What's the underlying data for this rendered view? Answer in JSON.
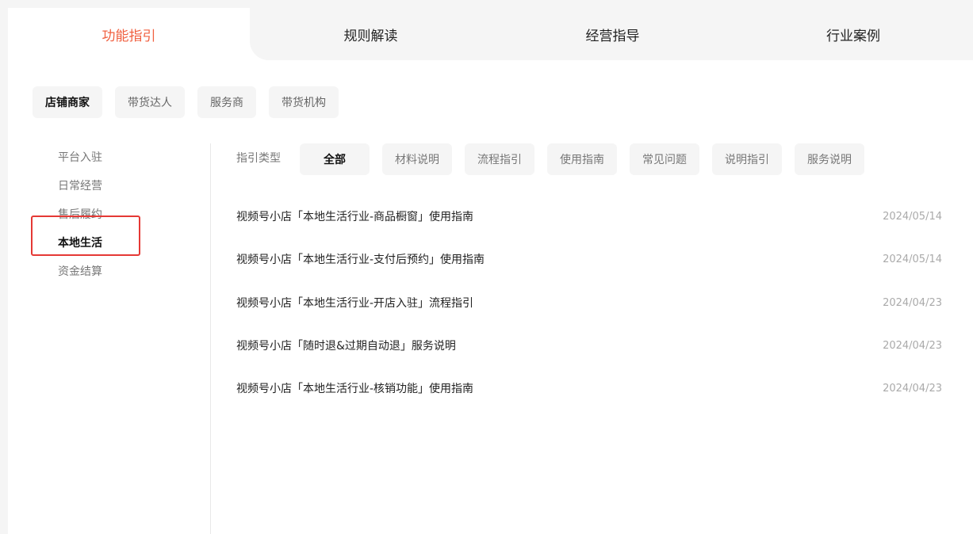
{
  "tabs": [
    {
      "label": "功能指引",
      "active": true
    },
    {
      "label": "规则解读",
      "active": false
    },
    {
      "label": "经营指导",
      "active": false
    },
    {
      "label": "行业案例",
      "active": false
    }
  ],
  "roles": [
    {
      "label": "店铺商家",
      "active": true
    },
    {
      "label": "带货达人",
      "active": false
    },
    {
      "label": "服务商",
      "active": false
    },
    {
      "label": "带货机构",
      "active": false
    }
  ],
  "sidenav": [
    {
      "label": "平台入驻",
      "active": false
    },
    {
      "label": "日常经营",
      "active": false
    },
    {
      "label": "售后履约",
      "active": false
    },
    {
      "label": "本地生活",
      "active": true
    },
    {
      "label": "资金结算",
      "active": false
    }
  ],
  "filter": {
    "label": "指引类型",
    "options": [
      {
        "label": "全部",
        "active": true
      },
      {
        "label": "材料说明",
        "active": false
      },
      {
        "label": "流程指引",
        "active": false
      },
      {
        "label": "使用指南",
        "active": false
      },
      {
        "label": "常见问题",
        "active": false
      },
      {
        "label": "说明指引",
        "active": false
      },
      {
        "label": "服务说明",
        "active": false
      }
    ]
  },
  "articles": [
    {
      "title": "视频号小店「本地生活行业-商品橱窗」使用指南",
      "date": "2024/05/14"
    },
    {
      "title": "视频号小店「本地生活行业-支付后预约」使用指南",
      "date": "2024/05/14"
    },
    {
      "title": "视频号小店「本地生活行业-开店入驻」流程指引",
      "date": "2024/04/23"
    },
    {
      "title": "视频号小店「随时退&过期自动退」服务说明",
      "date": "2024/04/23"
    },
    {
      "title": "视频号小店「本地生活行业-核销功能」使用指南",
      "date": "2024/04/23"
    }
  ],
  "colors": {
    "accent": "#f06040",
    "highlight_border": "#e53935"
  }
}
